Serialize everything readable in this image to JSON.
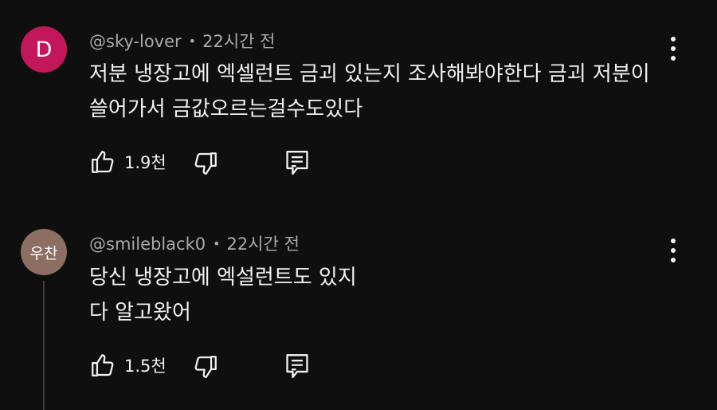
{
  "comments": [
    {
      "avatar_letter": "D",
      "avatar_color": "#c2185b",
      "author": "@sky-lover",
      "separator": "•",
      "time": "22시간 전",
      "lines": [
        "저분 냉장고에 엑셀런트 금괴 있는지 조사해봐야한다 금괴 저분이",
        "쓸어가서 금값오르는걸수도있다"
      ],
      "likes": "1.9천"
    },
    {
      "avatar_letter": "우찬",
      "avatar_color": "#8d6e63",
      "author": "@smileblack0",
      "separator": "•",
      "time": "22시간 전",
      "lines": [
        "당신 냉장고에 엑설런트도 있지",
        "다 알고왔어"
      ],
      "likes": "1.5천"
    }
  ],
  "icons": {
    "like": "thumbs-up-icon",
    "dislike": "thumbs-down-icon",
    "reply": "reply-icon",
    "menu": "more-vert-icon"
  },
  "colors": {
    "background": "#0f0f0f",
    "text": "#f1f1f1",
    "meta_text": "#aaaaaa",
    "thread_line": "#3d3d3d"
  }
}
